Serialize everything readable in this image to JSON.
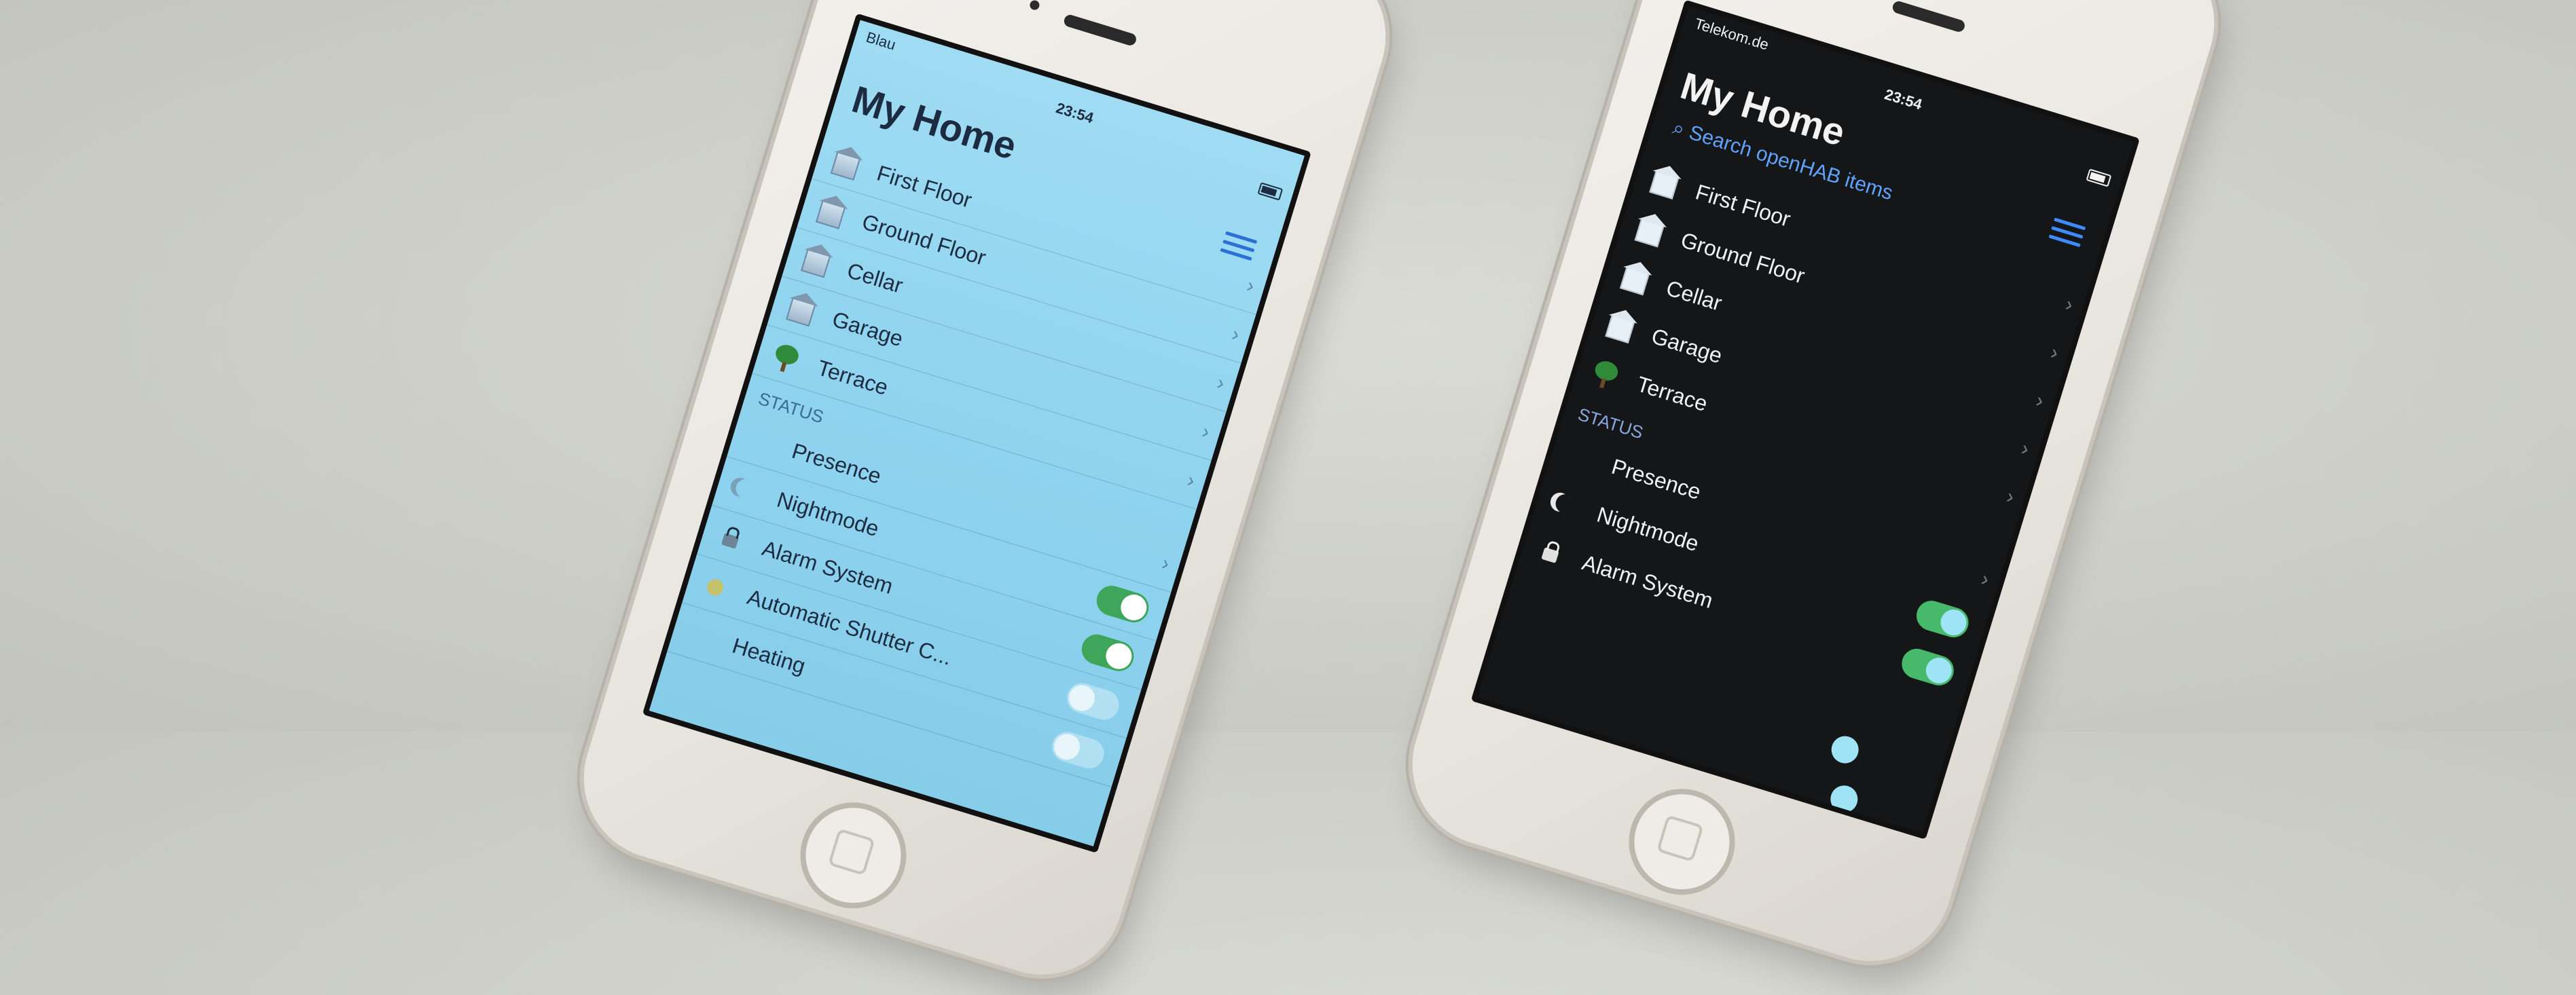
{
  "left_phone": {
    "status": {
      "carrier": "Blau",
      "time": "23:54"
    },
    "title": "My Home",
    "places": [
      {
        "label": "First Floor",
        "icon": "house-icon"
      },
      {
        "label": "Ground Floor",
        "icon": "house-icon"
      },
      {
        "label": "Cellar",
        "icon": "house-icon"
      },
      {
        "label": "Garage",
        "icon": "house-icon"
      },
      {
        "label": "Terrace",
        "icon": "tree-icon"
      }
    ],
    "section_label": "STATUS",
    "status_items": [
      {
        "label": "Presence",
        "icon": "none",
        "toggle": "none"
      },
      {
        "label": "Nightmode",
        "icon": "moon-icon",
        "toggle": "on"
      },
      {
        "label": "Alarm System",
        "icon": "lock-icon",
        "toggle": "on"
      },
      {
        "label": "Automatic Shutter C...",
        "icon": "dot-icon",
        "toggle": "off"
      },
      {
        "label": "Heating",
        "icon": "gauge-icon",
        "toggle": "off"
      }
    ],
    "theme": "light",
    "accent_color": "#2c6fd6"
  },
  "right_phone": {
    "status": {
      "carrier": "Telekom.de",
      "time": "23:54"
    },
    "title": "My Home",
    "search_placeholder": "Search openHAB items",
    "places": [
      {
        "label": "First Floor",
        "icon": "house-icon"
      },
      {
        "label": "Ground Floor",
        "icon": "house-icon"
      },
      {
        "label": "Cellar",
        "icon": "house-icon"
      },
      {
        "label": "Garage",
        "icon": "house-icon"
      },
      {
        "label": "Terrace",
        "icon": "tree-icon"
      }
    ],
    "section_label": "STATUS",
    "status_items": [
      {
        "label": "Presence",
        "icon": "none",
        "toggle": "none"
      },
      {
        "label": "Nightmode",
        "icon": "moon-icon",
        "toggle": "on"
      },
      {
        "label": "Alarm System",
        "icon": "lock-icon",
        "toggle": "on"
      }
    ],
    "theme": "dark",
    "accent_color": "#3d8bff"
  }
}
